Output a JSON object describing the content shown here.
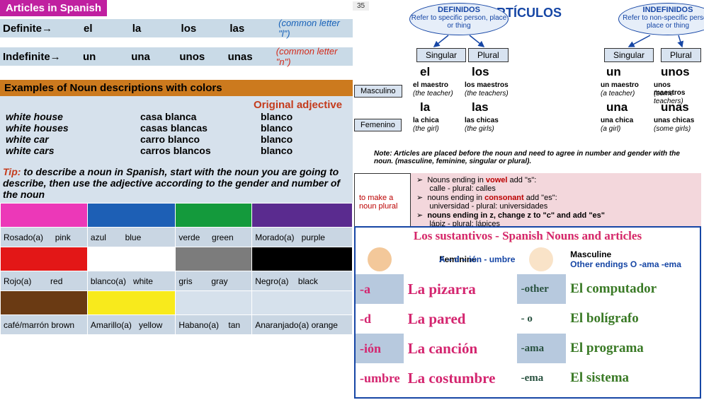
{
  "page_number": "35",
  "left": {
    "badge": "Articles in Spanish",
    "articles": {
      "definite": {
        "label": "Definite",
        "arrow": "→",
        "cells": [
          "el",
          "la",
          "los",
          "las"
        ],
        "note": "(common letter \"l\")"
      },
      "indefinite": {
        "label": "Indefinite",
        "arrow": "→",
        "cells": [
          "un",
          "una",
          "unos",
          "unas"
        ],
        "note": "(common letter \"n\")"
      }
    },
    "section2": "Examples of Noun descriptions with colors",
    "ex_header": "Original adjective",
    "examples": [
      {
        "en": "white house",
        "es": "casa blanca",
        "adj": "blanco"
      },
      {
        "en": "white houses",
        "es": "casas blancas",
        "adj": "blanco"
      },
      {
        "en": "white car",
        "es": "carro blanco",
        "adj": "blanco"
      },
      {
        "en": "white cars",
        "es": "carros blancos",
        "adj": "blanco"
      }
    ],
    "tip_label": "Tip:",
    "tip": " to describe a noun in Spanish, start with the noun you are going to describe, then use the adjective according to the gender and number of the noun",
    "colors": [
      [
        {
          "es": "Rosado(a)",
          "en": "pink"
        },
        {
          "es": "azul",
          "en": "blue"
        },
        {
          "es": "verde",
          "en": "green"
        },
        {
          "es": "Morado(a)",
          "en": "purple"
        }
      ],
      [
        {
          "es": "Rojo(a)",
          "en": "red"
        },
        {
          "es": "blanco(a)",
          "en": "white"
        },
        {
          "es": "gris",
          "en": "gray"
        },
        {
          "es": "Negro(a)",
          "en": "black"
        }
      ],
      [
        {
          "es": "café/marrón",
          "en": "brown"
        },
        {
          "es": "Amarillo(a)",
          "en": "yellow"
        },
        {
          "es": "Habano(a)",
          "en": "tan"
        },
        {
          "es": "Anaranjado(a)",
          "en": "orange"
        }
      ]
    ]
  },
  "right": {
    "title": "ARTÍCULOS",
    "definidos": {
      "head": "DEFINIDOS",
      "sub": "Refer to specific person, place or thing"
    },
    "indefinidos": {
      "head": "INDEFINIDOS",
      "sub": "Refer to non-specific person, place or thing"
    },
    "cols": [
      "Singular",
      "Plural",
      "Singular",
      "Plural"
    ],
    "rows": [
      "Masculino",
      "Femenino"
    ],
    "grid": {
      "m": [
        "el",
        "los",
        "un",
        "unos"
      ],
      "m_ex": [
        "el maestro",
        "los maestros",
        "un maestro",
        "unos maestros"
      ],
      "m_tr": [
        "(the teacher)",
        "(the teachers)",
        "(a teacher)",
        "(some teachers)"
      ],
      "f": [
        "la",
        "las",
        "una",
        "unas"
      ],
      "f_ex": [
        "la chica",
        "las chicas",
        "una chica",
        "unas chicas"
      ],
      "f_tr": [
        "(the girl)",
        "(the girls)",
        "(a girl)",
        "(some girls)"
      ]
    },
    "note": "Note: Articles are placed before the noun and need to agree in number and gender with the noun. (masculine, feminine, singular or plural).",
    "plural": {
      "label": "to make a noun plural",
      "r1a": "Nouns ending in ",
      "r1b": "vowel",
      "r1c": " add \"s\":",
      "r1ex": "calle -                          plural: calles",
      "r2a": "nouns ending in ",
      "r2b": "consonant",
      "r2c": " add \"es\":",
      "r2ex": "universidad -             plural: universidades",
      "r3": "nouns ending in z,  change z to \"c\" and add \"es\"",
      "r3ex": "lápiz -                          plural:  lápices"
    },
    "card": {
      "title": "Los sustantivos - Spanish Nouns and articles",
      "fem_label": "Feminine",
      "masc_label": "Masculine",
      "fem_rule": "A – d – ión - umbre",
      "masc_rule": "Other endings O -ama -ema",
      "fem_end": [
        "-a",
        "-d",
        "-ión",
        "-umbre"
      ],
      "fem_ex": [
        "La  pizarra",
        "La  pared",
        "La canción",
        "La costumbre"
      ],
      "masc_end": [
        "-other",
        "- o",
        "-ama",
        "-ema"
      ],
      "masc_ex": [
        "El  computador",
        "El bolígrafo",
        "El programa",
        "El sistema"
      ]
    }
  }
}
